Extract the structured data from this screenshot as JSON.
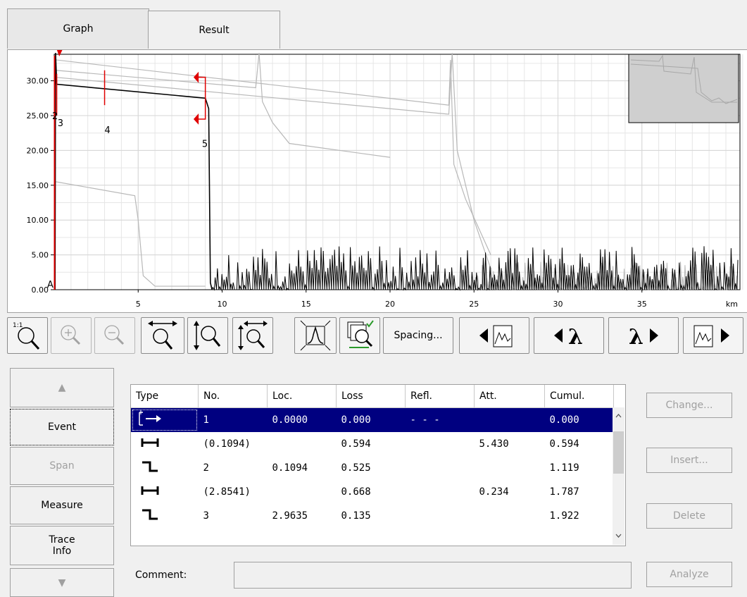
{
  "tabs": {
    "graph": "Graph",
    "result": "Result"
  },
  "graph": {
    "y_ticks": [
      "30.00",
      "25.00",
      "20.00",
      "15.00",
      "10.00",
      "5.00",
      "0.00"
    ],
    "x_ticks": [
      "5",
      "10",
      "15",
      "20",
      "25",
      "30",
      "35"
    ],
    "x_unit": "km",
    "marker_a": "A",
    "event_markers": [
      "2",
      "3",
      "4",
      "5"
    ]
  },
  "toolbar": {
    "spacing": "Spacing...",
    "zoom_reset_label": "1:1"
  },
  "nav": {
    "up": "▲",
    "event": "Event",
    "span": "Span",
    "measure": "Measure",
    "trace_info": "Trace Info",
    "down": "▼"
  },
  "events_table": {
    "headers": [
      "Type",
      "No.",
      "Loc.",
      "Loss",
      "Refl.",
      "Att.",
      "Cumul."
    ],
    "rows": [
      {
        "type": "launch",
        "no": "1",
        "loc": "0.0000",
        "loss": "0.000",
        "refl": "- - -",
        "att": "",
        "cumul": "0.000"
      },
      {
        "type": "span",
        "no": "(0.1094)",
        "loc": "",
        "loss": "0.594",
        "refl": "",
        "att": "5.430",
        "cumul": "0.594"
      },
      {
        "type": "nonreflective",
        "no": "2",
        "loc": "0.1094",
        "loss": "0.525",
        "refl": "",
        "att": "",
        "cumul": "1.119"
      },
      {
        "type": "span",
        "no": "(2.8541)",
        "loc": "",
        "loss": "0.668",
        "refl": "",
        "att": "0.234",
        "cumul": "1.787"
      },
      {
        "type": "nonreflective",
        "no": "3",
        "loc": "2.9635",
        "loss": "0.135",
        "refl": "",
        "att": "",
        "cumul": "1.922"
      }
    ]
  },
  "buttons": {
    "change": "Change...",
    "insert": "Insert...",
    "delete": "Delete",
    "analyze": "Analyze"
  },
  "comment": {
    "label": "Comment:",
    "value": ""
  }
}
